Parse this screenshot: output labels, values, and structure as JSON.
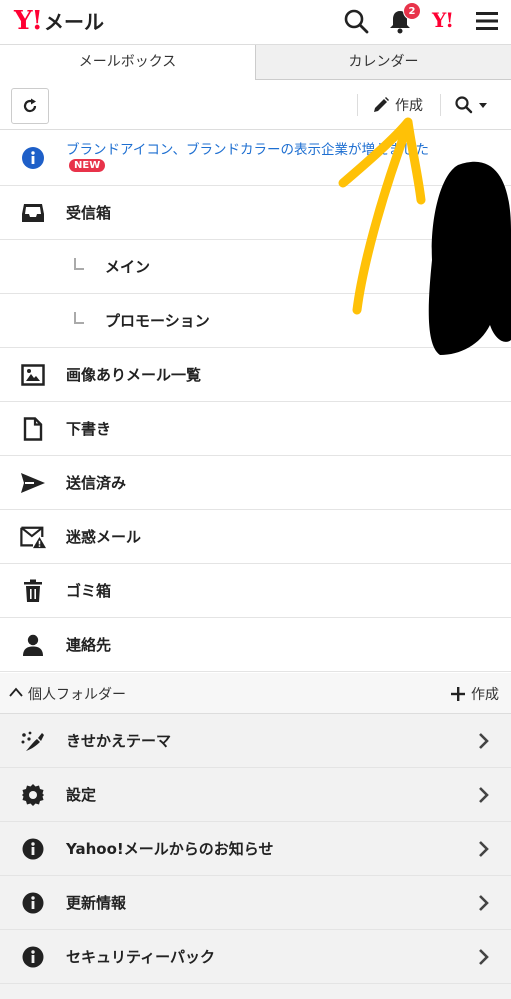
{
  "header": {
    "logo_mark": "Y!",
    "logo_text": "メール",
    "notification_count": "2",
    "yj_mark": "Y!"
  },
  "tabs": [
    {
      "label": "メールボックス",
      "active": true
    },
    {
      "label": "カレンダー",
      "active": false
    }
  ],
  "toolbar": {
    "compose_label": "作成"
  },
  "notice": {
    "text": "ブランドアイコン、ブランドカラーの表示企業が増えました",
    "badge": "NEW"
  },
  "folders": {
    "inbox": "受信箱",
    "main": "メイン",
    "promotion": "プロモーション",
    "images": "画像ありメール一覧",
    "drafts": "下書き",
    "sent": "送信済み",
    "spam": "迷惑メール",
    "trash": "ゴミ箱",
    "contacts": "連絡先"
  },
  "personal_folders": {
    "label": "個人フォルダー",
    "create_label": "作成"
  },
  "menu": {
    "theme": "きせかえテーマ",
    "settings": "設定",
    "news": "Yahoo!メールからのお知らせ",
    "updates": "更新情報",
    "security": "セキュリティーパック"
  },
  "colors": {
    "brand_red": "#ff0033",
    "link_blue": "#1e6fd1",
    "badge_red": "#e8334a",
    "arrow_yellow": "#ffc107"
  }
}
